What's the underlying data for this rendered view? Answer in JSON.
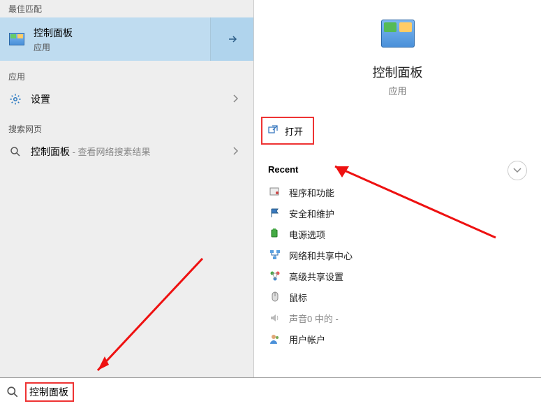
{
  "left": {
    "best_match_header": "最佳匹配",
    "best_match": {
      "title": "控制面板",
      "subtitle": "应用"
    },
    "apps_header": "应用",
    "settings_label": "设置",
    "web_header": "搜索网页",
    "web_item_text": "控制面板",
    "web_item_suffix": " - 查看网络搜素结果"
  },
  "right": {
    "title": "控制面板",
    "subtitle": "应用",
    "open_label": "打开",
    "recent_header": "Recent",
    "recent": [
      {
        "label": "程序和功能"
      },
      {
        "label": "安全和维护"
      },
      {
        "label": "电源选项"
      },
      {
        "label": "网络和共享中心"
      },
      {
        "label": "高级共享设置"
      },
      {
        "label": "鼠标"
      },
      {
        "label": "声音0 中的 -"
      },
      {
        "label": "用户帐户"
      }
    ]
  },
  "search": {
    "value": "控制面板"
  }
}
